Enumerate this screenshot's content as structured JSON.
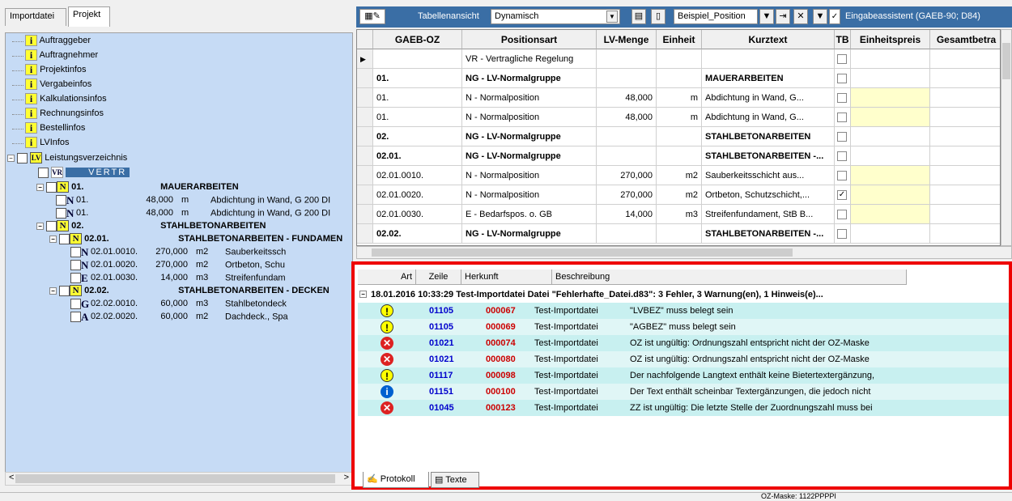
{
  "left_tabs": [
    "Importdatei",
    "Projekt"
  ],
  "tree": {
    "info_items": [
      "Auftraggeber",
      "Auftragnehmer",
      "Projektinfos",
      "Vergabeinfos",
      "Kalkulationsinfos",
      "Rechnungsinfos",
      "Bestellinfos",
      "LVInfos"
    ],
    "lv_label": "Leistungsverzeichnis",
    "vertr": "VERTR",
    "rows": [
      {
        "badge": "N",
        "oz": "01.",
        "text": "MAUERARBEITEN",
        "group": true
      },
      {
        "badge": "N",
        "oz": "01.",
        "menge": "48,000",
        "einheit": "m",
        "text": "Abdichtung in Wand, G 200 DI"
      },
      {
        "badge": "N",
        "oz": "01.",
        "menge": "48,000",
        "einheit": "m",
        "text": "Abdichtung in Wand, G 200 DI"
      },
      {
        "badge": "N",
        "oz": "02.",
        "text": "STAHLBETONARBEITEN",
        "group": true
      },
      {
        "badge": "N",
        "oz": "02.01.",
        "text": "STAHLBETONARBEITEN - FUNDAMEN",
        "group": true
      },
      {
        "badge": "N",
        "oz": "02.01.0010.",
        "menge": "270,000",
        "einheit": "m2",
        "text": "Sauberkeitssch"
      },
      {
        "badge": "N",
        "oz": "02.01.0020.",
        "menge": "270,000",
        "einheit": "m2",
        "text": "Ortbeton, Schu"
      },
      {
        "badge": "E",
        "oz": "02.01.0030.",
        "menge": "14,000",
        "einheit": "m3",
        "text": "Streifenfundam"
      },
      {
        "badge": "N",
        "oz": "02.02.",
        "text": "STAHLBETONARBEITEN - DECKEN",
        "group": true
      },
      {
        "badge": "G",
        "oz": "02.02.0010.",
        "menge": "60,000",
        "einheit": "m3",
        "text": "Stahlbetondeck"
      },
      {
        "badge": "A",
        "oz": "02.02.0020.",
        "menge": "60,000",
        "einheit": "m2",
        "text": "Dachdeck., Spa"
      }
    ]
  },
  "toolbar": {
    "view_label": "Tabellenansicht",
    "view_value": "Dynamisch",
    "position_label": "Beispiel_Position",
    "assistant_label": "Eingabeassistent (GAEB-90; D84)"
  },
  "grid": {
    "headers": [
      "GAEB-OZ",
      "Positionsart",
      "LV-Menge",
      "Einheit",
      "Kurztext",
      "TB",
      "Einheitspreis",
      "Gesamtbetra"
    ],
    "rows": [
      {
        "oz": "",
        "art": "VR - Vertragliche Regelung",
        "menge": "",
        "einheit": "",
        "kurz": "",
        "tb": false,
        "bold": false,
        "yellow": false
      },
      {
        "oz": "01.",
        "art": "NG - LV-Normalgruppe",
        "menge": "",
        "einheit": "",
        "kurz": "MAUERARBEITEN",
        "tb": false,
        "bold": true,
        "yellow": false
      },
      {
        "oz": "01.",
        "art": "N - Normalposition",
        "menge": "48,000",
        "einheit": "m",
        "kurz": "Abdichtung in Wand, G...",
        "tb": false,
        "bold": false,
        "yellow": true
      },
      {
        "oz": "01.",
        "art": "N - Normalposition",
        "menge": "48,000",
        "einheit": "m",
        "kurz": "Abdichtung in Wand, G...",
        "tb": false,
        "bold": false,
        "yellow": true
      },
      {
        "oz": "02.",
        "art": "NG - LV-Normalgruppe",
        "menge": "",
        "einheit": "",
        "kurz": "STAHLBETONARBEITEN",
        "tb": false,
        "bold": true,
        "yellow": false
      },
      {
        "oz": "02.01.",
        "art": "NG - LV-Normalgruppe",
        "menge": "",
        "einheit": "",
        "kurz": "STAHLBETONARBEITEN -...",
        "tb": false,
        "bold": true,
        "yellow": false
      },
      {
        "oz": "02.01.0010.",
        "art": "N - Normalposition",
        "menge": "270,000",
        "einheit": "m2",
        "kurz": "Sauberkeitsschicht aus...",
        "tb": false,
        "bold": false,
        "yellow": true
      },
      {
        "oz": "02.01.0020.",
        "art": "N - Normalposition",
        "menge": "270,000",
        "einheit": "m2",
        "kurz": "Ortbeton, Schutzschicht,...",
        "tb": true,
        "bold": false,
        "yellow": true
      },
      {
        "oz": "02.01.0030.",
        "art": "E - Bedarfspos. o. GB",
        "menge": "14,000",
        "einheit": "m3",
        "kurz": "Streifenfundament, StB B...",
        "tb": false,
        "bold": false,
        "yellow": true
      },
      {
        "oz": "02.02.",
        "art": "NG - LV-Normalgruppe",
        "menge": "",
        "einheit": "",
        "kurz": "STAHLBETONARBEITEN -...",
        "tb": false,
        "bold": true,
        "yellow": false
      }
    ]
  },
  "protocol": {
    "headers": [
      "Art",
      "Zeile",
      "Herkunft",
      "Beschreibung"
    ],
    "summary": "18.01.2016 10:33:29 Test-Importdatei Datei \"Fehlerhafte_Datei.d83\": 3 Fehler, 3 Warnung(en), 1 Hinweis(e)...",
    "rows": [
      {
        "type": "warn",
        "art": "01105",
        "zeile": "000067",
        "herkunft": "Test-Importdatei",
        "text": "\"LVBEZ\" muss belegt sein"
      },
      {
        "type": "warn",
        "art": "01105",
        "zeile": "000069",
        "herkunft": "Test-Importdatei",
        "text": "\"AGBEZ\" muss belegt sein"
      },
      {
        "type": "err",
        "art": "01021",
        "zeile": "000074",
        "herkunft": "Test-Importdatei",
        "text": "OZ ist ungültig: Ordnungszahl entspricht nicht der OZ-Maske"
      },
      {
        "type": "err",
        "art": "01021",
        "zeile": "000080",
        "herkunft": "Test-Importdatei",
        "text": "OZ ist ungültig: Ordnungszahl entspricht nicht der OZ-Maske"
      },
      {
        "type": "warn",
        "art": "01117",
        "zeile": "000098",
        "herkunft": "Test-Importdatei",
        "text": "Der nachfolgende Langtext enthält keine Bietertextergänzung,"
      },
      {
        "type": "info",
        "art": "01151",
        "zeile": "000100",
        "herkunft": "Test-Importdatei",
        "text": "Der Text enthält scheinbar Textergänzungen, die jedoch nicht"
      },
      {
        "type": "err",
        "art": "01045",
        "zeile": "000123",
        "herkunft": "Test-Importdatei",
        "text": "ZZ ist ungültig: Die letzte Stelle der Zuordnungszahl muss bei"
      }
    ],
    "tabs": [
      "Protokoll",
      "Texte"
    ]
  },
  "status": {
    "oz_mask": "OZ-Maske: 1122PPPPI"
  },
  "colors": {
    "tree_bg": "#c6dbf5",
    "toolbar_bg": "#3a6ea5",
    "highlight": "#ee0000",
    "row_even": "#ccf0f0",
    "row_odd": "#e6f8f8",
    "art_color": "#0000cc",
    "zeile_color": "#cc0000"
  }
}
